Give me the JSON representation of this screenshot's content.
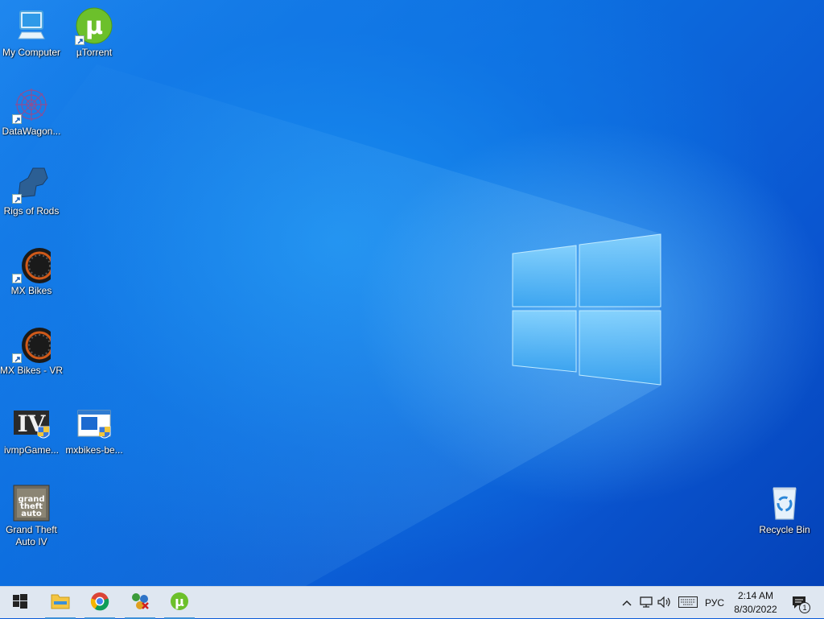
{
  "desktop": {
    "icons": [
      {
        "label": "My Computer",
        "icon": "computer-icon"
      },
      {
        "label": "µTorrent",
        "icon": "utorrent-icon"
      },
      {
        "label": "DataWagon...",
        "icon": "datawagon-icon"
      },
      {
        "label": "Rigs of Rods",
        "icon": "rigs-of-rods-icon"
      },
      {
        "label": "MX Bikes",
        "icon": "mx-bikes-icon"
      },
      {
        "label": "MX Bikes - VR",
        "icon": "mx-bikes-vr-icon"
      },
      {
        "label": "ivmpGame...",
        "icon": "ivmp-icon"
      },
      {
        "label": "mxbikes-be...",
        "icon": "installer-icon"
      },
      {
        "label": "Grand Theft Auto IV",
        "icon": "gta-iv-icon"
      },
      {
        "label": "Recycle Bin",
        "icon": "recycle-bin-icon"
      }
    ]
  },
  "taskbar": {
    "start": "start-icon",
    "pinned": [
      {
        "name": "File Explorer",
        "icon": "folder-icon",
        "active": true
      },
      {
        "name": "Google Chrome",
        "icon": "chrome-icon",
        "active": true
      },
      {
        "name": "Network app",
        "icon": "network-app-icon",
        "active": true
      },
      {
        "name": "µTorrent",
        "icon": "utorrent-icon",
        "active": true
      }
    ],
    "tray": {
      "language": "РУС",
      "time": "2:14 AM",
      "date": "8/30/2022",
      "notifications": "1"
    }
  },
  "colors": {
    "accent": "#3c8fd8",
    "taskbar": "#dfe7f1",
    "utorrent_green": "#6cc02b"
  }
}
